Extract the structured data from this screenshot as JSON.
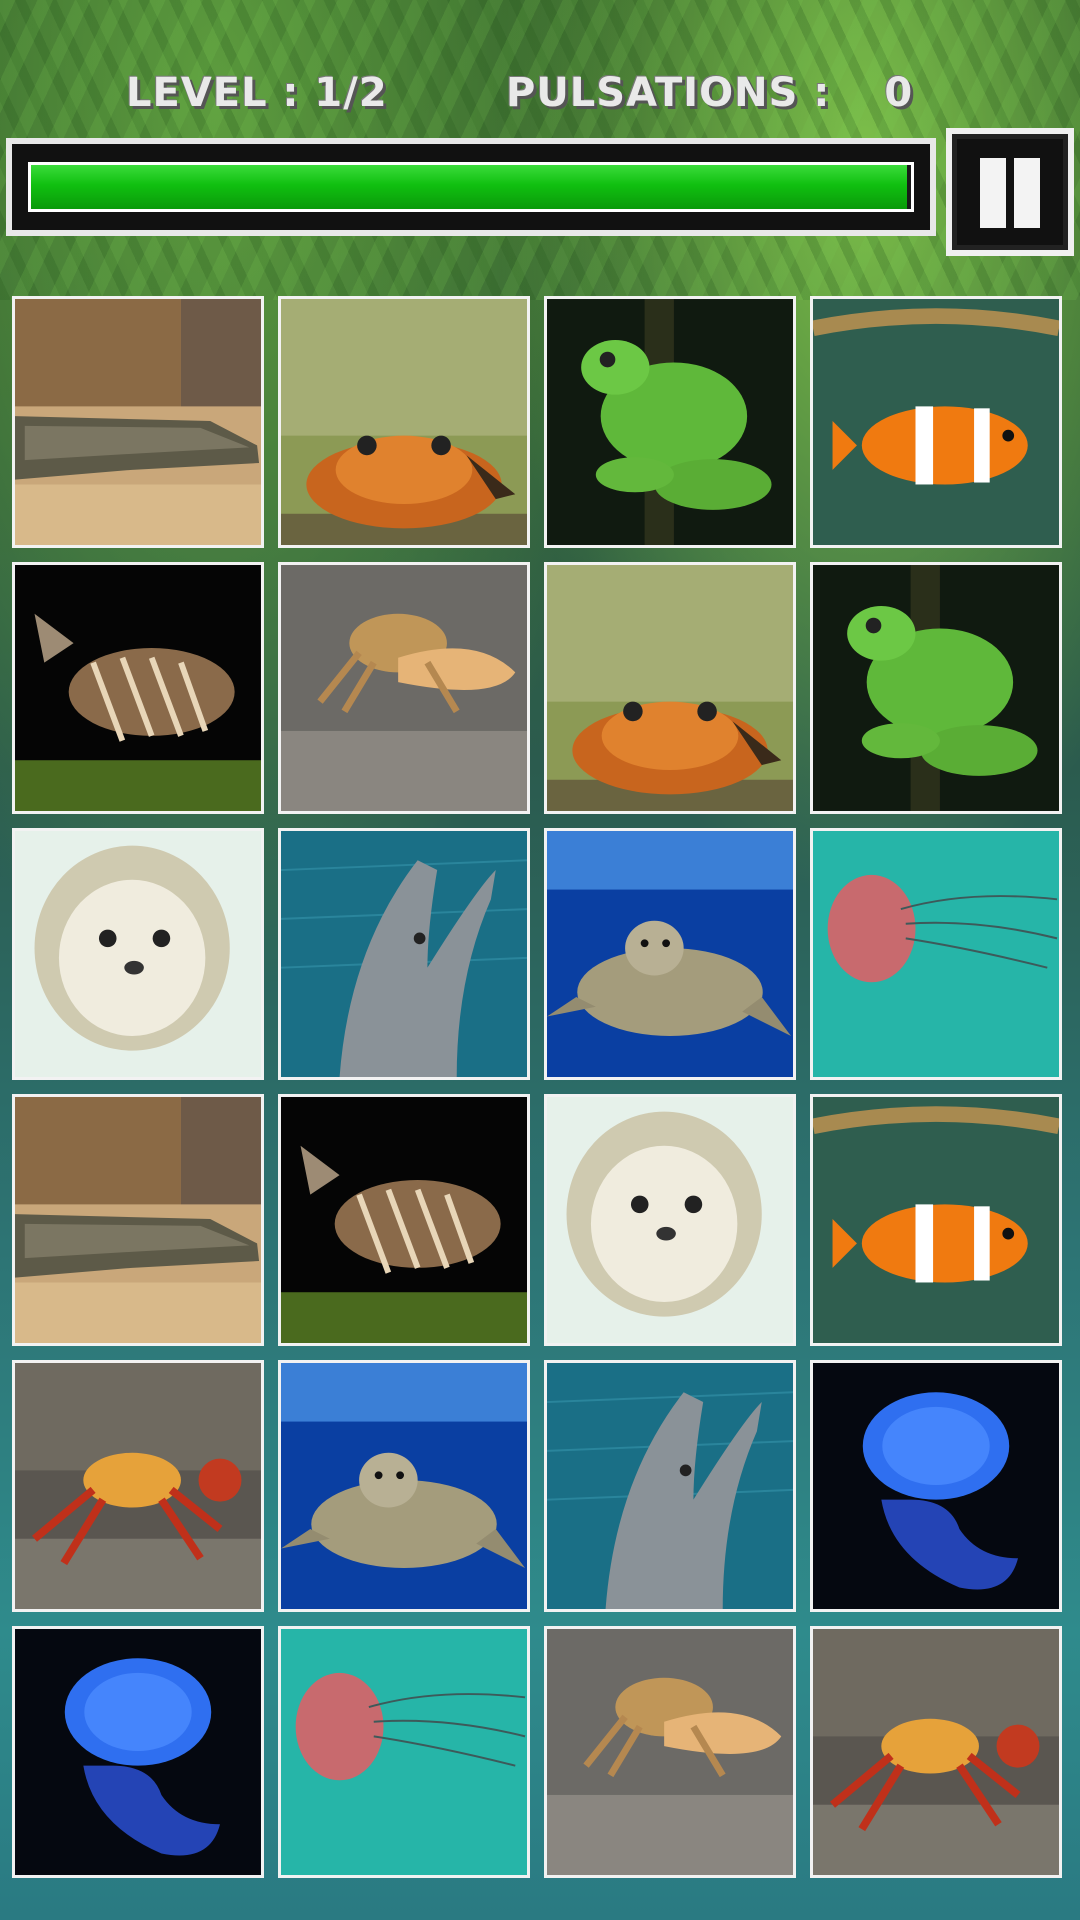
{
  "hud": {
    "level_text": "LEVEL : 1/2",
    "pulsations_label": "PULSATIONS :",
    "pulsations_value": "0"
  },
  "time_bar": {
    "fill_fraction": 0.995,
    "color": "#10c010"
  },
  "pause_button": {
    "icon": "pause-icon"
  },
  "grid": {
    "rows": 6,
    "cols": 4,
    "cards": [
      "crocodile",
      "toad",
      "tree-frog",
      "clownfish",
      "lionfish",
      "fiddler-crab",
      "toad",
      "tree-frog",
      "seal",
      "dolphin",
      "sea-turtle",
      "lions-mane-jellyfish",
      "crocodile",
      "lionfish",
      "seal",
      "clownfish",
      "red-crab",
      "sea-turtle",
      "dolphin",
      "moon-jellyfish",
      "moon-jellyfish",
      "lions-mane-jellyfish",
      "fiddler-crab",
      "red-crab"
    ]
  }
}
